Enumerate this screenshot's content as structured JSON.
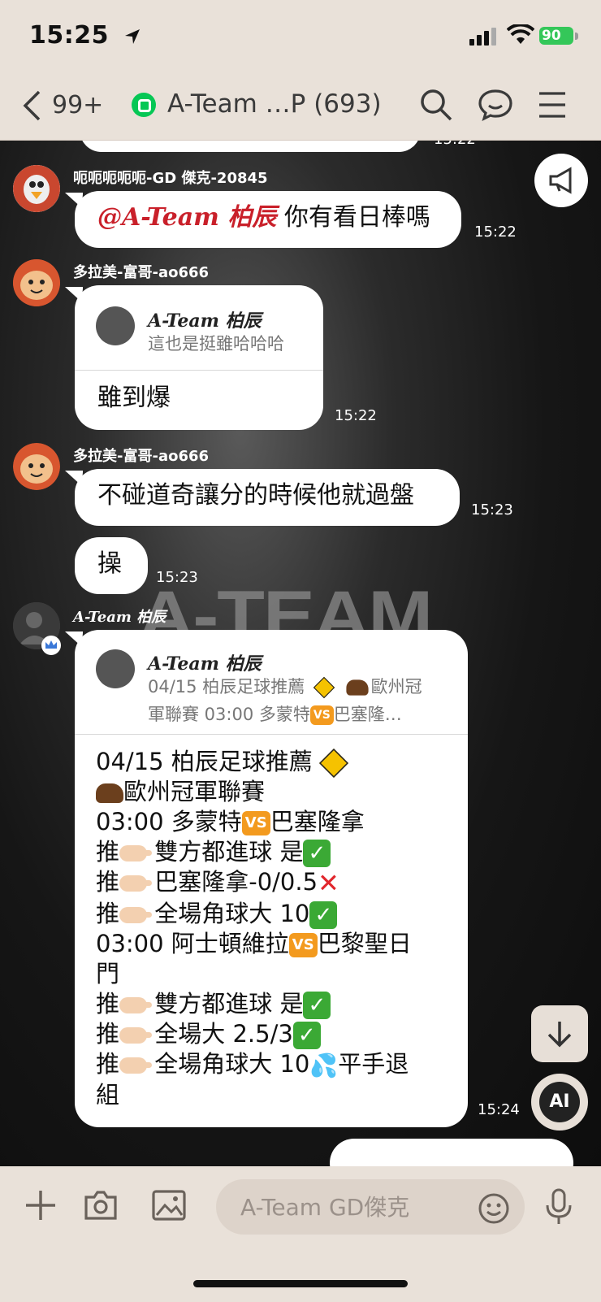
{
  "status_bar": {
    "time": "15:25",
    "battery": "90"
  },
  "header": {
    "back_count": "99+",
    "title": "A-Team …P (693)"
  },
  "colors": {
    "online_green": "#06c755",
    "mention_red": "#c9202a",
    "bubble": "#ffffff",
    "header_bg": "#e9e1d9"
  },
  "watermark": "A-TEAM",
  "messages": {
    "top_time": "15:22",
    "m1": {
      "sender": "呃呃呃呃呃-GD 傑克-20845",
      "mention": "@A-Team 柏辰",
      "text": "你有看日棒嗎",
      "time": "15:22"
    },
    "m2": {
      "sender": "多拉美-富哥-ao666",
      "quote_name": "A-Team 柏辰",
      "quote_text": "這也是挺雖哈哈哈",
      "text": "雖到爆",
      "time": "15:22"
    },
    "m3": {
      "sender": "多拉美-富哥-ao666",
      "text": "不碰道奇讓分的時候他就過盤",
      "time": "15:23"
    },
    "m4": {
      "text": "操",
      "time": "15:23"
    },
    "m5": {
      "sender": "A-Team 柏辰",
      "quote_name": "A-Team 柏辰",
      "quote_line1": "04/15 柏辰足球推薦",
      "quote_line1b": "歐州冠",
      "quote_line2": "軍聯賽 03:00 多蒙特",
      "quote_line2b": "巴塞隆…",
      "lines": {
        "l1": "04/15 柏辰足球推薦",
        "l2": "歐州冠軍聯賽",
        "l3a": "03:00 多蒙特",
        "l3b": "巴塞隆拿",
        "l4": "推",
        "l4b": "雙方都進球 是",
        "l5b": "巴塞隆拿-0/0.5",
        "l6b": "全場角球大 10",
        "l7a": "03:00 阿士頓維拉",
        "l7b": "巴黎聖日",
        "l8": "門",
        "l9b": "雙方都進球 是",
        "l10b": "全場大 2.5/3",
        "l11b": "全場角球大 10",
        "l11c": "平手退",
        "l12": "組"
      },
      "vs": "VS",
      "time": "15:24"
    }
  },
  "ai_label": "AI",
  "input": {
    "placeholder": "A-Team GD傑克"
  }
}
